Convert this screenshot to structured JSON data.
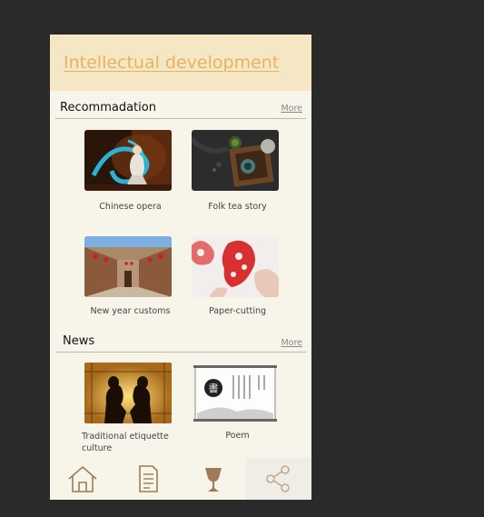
{
  "header": {
    "title": "Intellectual development"
  },
  "recommendation": {
    "title": "Recommadation",
    "more_label": "More",
    "cards": [
      {
        "caption": "Chinese opera",
        "image": "opera-performer-image"
      },
      {
        "caption": "Folk tea story",
        "image": "tea-set-image"
      },
      {
        "caption": "New year customs",
        "image": "courtyard-lanterns-image"
      },
      {
        "caption": "Paper-cutting",
        "image": "paper-cutting-image"
      }
    ]
  },
  "news": {
    "title": "News",
    "more_label": "More",
    "cards": [
      {
        "caption": "Traditional etiquette culture",
        "image": "etiquette-silhouette-image"
      },
      {
        "caption": "Poem",
        "image": "calligraphy-scroll-image"
      }
    ]
  },
  "tabbar": {
    "items": [
      {
        "icon": "home-icon"
      },
      {
        "icon": "document-icon"
      },
      {
        "icon": "goblet-icon",
        "active": true
      },
      {
        "icon": "share-icon"
      }
    ]
  },
  "colors": {
    "background": "#2a2a2a",
    "page": "#f7f4ea",
    "header": "#f5e6c4",
    "title_accent": "#e9b25f",
    "icon_brown": "#a07a56"
  }
}
